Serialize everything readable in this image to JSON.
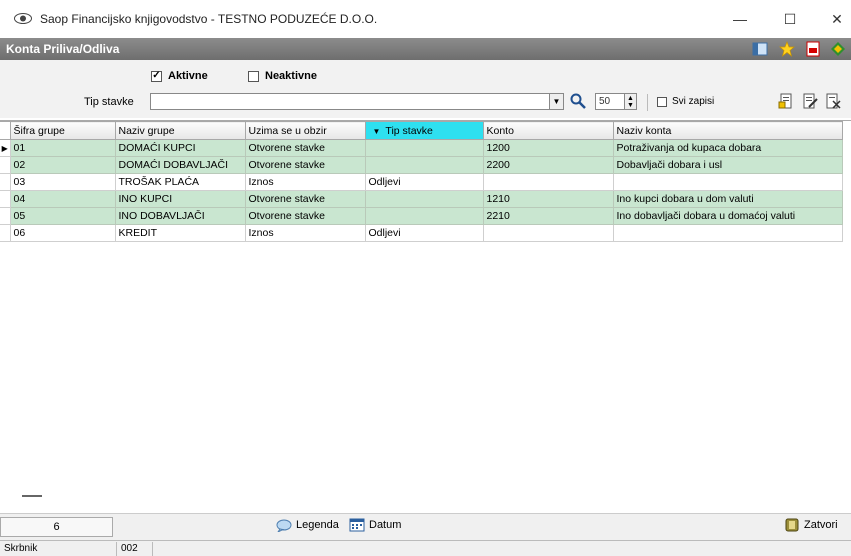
{
  "window": {
    "title": "Saop  Financijsko knjigovodstvo - TESTNO PODUZEĆE D.O.O.",
    "minimize": "—",
    "maximize": "☐",
    "close": "✕"
  },
  "module": {
    "title": "Konta Priliva/Odliva"
  },
  "filters": {
    "aktivne_label": "Aktivne",
    "aktivne_checked": true,
    "neaktivne_label": "Neaktivne",
    "neaktivne_checked": false,
    "tip_stavke_label": "Tip stavke",
    "tip_stavke_value": "",
    "record_count": "50",
    "svi_zapisi_label": "Svi zapisi"
  },
  "table": {
    "columns": [
      "Šifra grupe",
      "Naziv grupe",
      "Uzima se u obzir",
      "Tip stavke",
      "Konto",
      "Naziv konta"
    ],
    "sorted_column": "Tip stavke",
    "rows": [
      [
        "01",
        "DOMAĆI KUPCI",
        "Otvorene stavke",
        "",
        "1200",
        "Potraživanja od kupaca dobara"
      ],
      [
        "02",
        "DOMAĆI DOBAVLJAČI",
        "Otvorene stavke",
        "",
        "2200",
        "Dobavljači dobara i usl"
      ],
      [
        "03",
        "TROŠAK PLAĆA",
        "Iznos",
        "Odljevi",
        "",
        ""
      ],
      [
        "04",
        "INO KUPCI",
        "Otvorene stavke",
        "",
        "1210",
        "Ino kupci dobara u dom valuti"
      ],
      [
        "05",
        "INO DOBAVLJAČI",
        "Otvorene stavke",
        "",
        "2210",
        "Ino dobavljači dobara u domaćoj valuti"
      ],
      [
        "06",
        "KREDIT",
        "Iznos",
        "Odljevi",
        "",
        ""
      ]
    ],
    "row_styles": [
      "green",
      "green",
      "white",
      "green",
      "green",
      "white"
    ],
    "current_row": 0
  },
  "bottom": {
    "row_count": "6",
    "legenda_label": "Legenda",
    "datum_label": "Datum",
    "zatvori_label": "Zatvori"
  },
  "status": {
    "user": "Skrbnik",
    "code": "002"
  },
  "colors": {
    "green_row": "#c9e6d0",
    "sorted_header": "#2ee0f0",
    "module_bar": "#7a7a7a"
  }
}
